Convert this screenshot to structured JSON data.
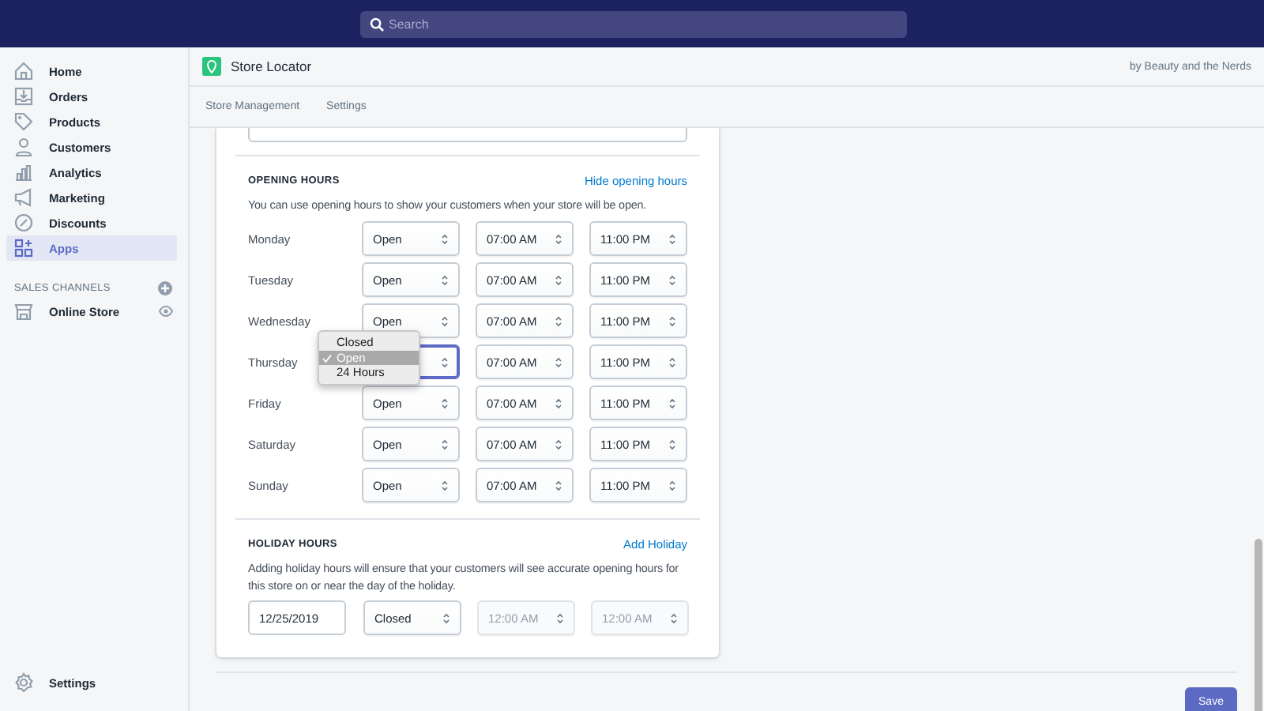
{
  "search": {
    "placeholder": "Search"
  },
  "sidebar": {
    "items": [
      {
        "label": "Home",
        "selected": false
      },
      {
        "label": "Orders",
        "selected": false
      },
      {
        "label": "Products",
        "selected": false
      },
      {
        "label": "Customers",
        "selected": false
      },
      {
        "label": "Analytics",
        "selected": false
      },
      {
        "label": "Marketing",
        "selected": false
      },
      {
        "label": "Discounts",
        "selected": false
      },
      {
        "label": "Apps",
        "selected": true
      }
    ],
    "sales_channels": {
      "title": "SALES CHANNELS",
      "items": [
        {
          "label": "Online Store"
        }
      ]
    },
    "settings": "Settings"
  },
  "app": {
    "title": "Store Locator",
    "byline": "by Beauty and the Nerds"
  },
  "tabs": [
    {
      "label": "Store Management"
    },
    {
      "label": "Settings"
    }
  ],
  "opening_hours": {
    "title": "OPENING HOURS",
    "action": "Hide opening hours",
    "description": "You can use opening hours to show your customers when your store will be open.",
    "days": [
      {
        "day": "Monday",
        "status": "Open",
        "open": "07:00 AM",
        "close": "11:00 PM",
        "focused": false
      },
      {
        "day": "Tuesday",
        "status": "Open",
        "open": "07:00 AM",
        "close": "11:00 PM",
        "focused": false
      },
      {
        "day": "Wednesday",
        "status": "Open",
        "open": "07:00 AM",
        "close": "11:00 PM",
        "focused": false
      },
      {
        "day": "Thursday",
        "open": "07:00 AM",
        "close": "11:00 PM",
        "focused": true
      },
      {
        "day": "Friday",
        "status": "Open",
        "open": "07:00 AM",
        "close": "11:00 PM",
        "focused": false
      },
      {
        "day": "Saturday",
        "status": "Open",
        "open": "07:00 AM",
        "close": "11:00 PM",
        "focused": false
      },
      {
        "day": "Sunday",
        "status": "Open",
        "open": "07:00 AM",
        "close": "11:00 PM",
        "focused": false
      }
    ],
    "dropdown": {
      "options": [
        {
          "label": "Closed",
          "selected": false
        },
        {
          "label": "Open",
          "selected": true
        },
        {
          "label": "24 Hours",
          "selected": false
        }
      ]
    }
  },
  "holiday_hours": {
    "title": "HOLIDAY HOURS",
    "action": "Add Holiday",
    "description": "Adding holiday hours will ensure that your customers will see accurate opening hours for this store on or near the day of the holiday.",
    "entries": [
      {
        "date": "12/25/2019",
        "status": "Closed",
        "open": "12:00 AM",
        "close": "12:00 AM",
        "times_disabled": true
      }
    ]
  },
  "save": "Save"
}
